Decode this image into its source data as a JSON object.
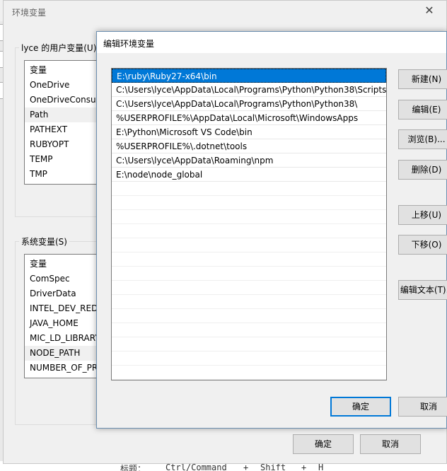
{
  "background": {
    "fragments": [
      "标题：",
      "Ctrl/Command",
      "+",
      "Shift",
      "+",
      "H"
    ]
  },
  "env_window": {
    "title": "环境变量",
    "close_glyph": "✕",
    "user_group_label": "lyce 的用户变量(U)",
    "user_vars": {
      "header": "变量",
      "items": [
        "OneDrive",
        "OneDriveConsumer",
        "Path",
        "PATHEXT",
        "RUBYOPT",
        "TEMP",
        "TMP"
      ],
      "selected_index": 2
    },
    "system_group_label": "系统变量(S)",
    "system_vars": {
      "header": "变量",
      "items": [
        "ComSpec",
        "DriverData",
        "INTEL_DEV_REDIST",
        "JAVA_HOME",
        "MIC_LD_LIBRARY_PATH",
        "NODE_PATH",
        "NUMBER_OF_PROCESSORS"
      ],
      "selected_index": 5
    },
    "ok_label": "确定",
    "cancel_label": "取消"
  },
  "edit_dialog": {
    "title": "编辑环境变量",
    "paths": [
      "E:\\ruby\\Ruby27-x64\\bin",
      "C:\\Users\\lyce\\AppData\\Local\\Programs\\Python\\Python38\\Scripts\\",
      "C:\\Users\\lyce\\AppData\\Local\\Programs\\Python\\Python38\\",
      "%USERPROFILE%\\AppData\\Local\\Microsoft\\WindowsApps",
      "E:\\Python\\Microsoft VS Code\\bin",
      "%USERPROFILE%\\.dotnet\\tools",
      "C:\\Users\\lyce\\AppData\\Roaming\\npm",
      "E:\\node\\node_global"
    ],
    "selected_index": 0,
    "buttons": {
      "new": "新建(N)",
      "edit": "编辑(E)",
      "browse": "浏览(B)...",
      "delete": "删除(D)",
      "move_up": "上移(U)",
      "move_down": "下移(O)",
      "edit_text": "编辑文本(T)..."
    },
    "ok_label": "确定",
    "cancel_label": "取消",
    "accent_color": "#0078d7"
  }
}
